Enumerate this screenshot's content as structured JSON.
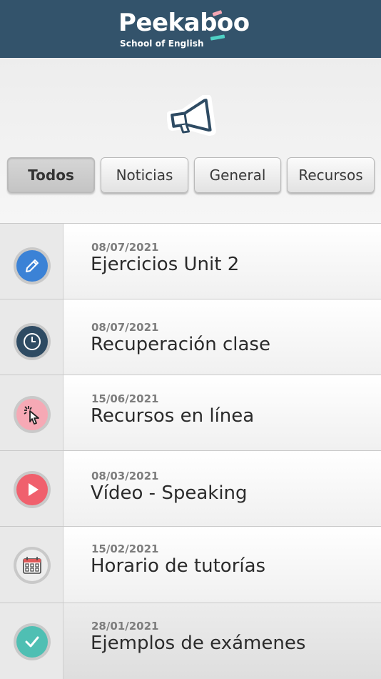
{
  "brand": {
    "name": "Peekaboo",
    "subtitle": "School of English",
    "header_color": "#33536b"
  },
  "tabs": [
    {
      "label": "Todos",
      "active": true
    },
    {
      "label": "Noticias",
      "active": false
    },
    {
      "label": "General",
      "active": false
    },
    {
      "label": "Recursos",
      "active": false
    }
  ],
  "items": [
    {
      "date": "08/07/2021",
      "title": "Ejercicios Unit 2",
      "icon": "pencil-icon",
      "color": "#3b82d6"
    },
    {
      "date": "08/07/2021",
      "title": "Recuperación clase",
      "icon": "clock-icon",
      "color": "#2e4b63"
    },
    {
      "date": "15/06/2021",
      "title": "Recursos en línea",
      "icon": "cursor-click-icon",
      "color": "#f6a9b5"
    },
    {
      "date": "08/03/2021",
      "title": "Vídeo - Speaking",
      "icon": "play-icon",
      "color": "#f0606d"
    },
    {
      "date": "15/02/2021",
      "title": "Horario de tutorías",
      "icon": "calendar-icon",
      "color": "#ededed"
    },
    {
      "date": "28/01/2021",
      "title": "Ejemplos de exámenes",
      "icon": "check-icon",
      "color": "#4fbfb3"
    }
  ]
}
